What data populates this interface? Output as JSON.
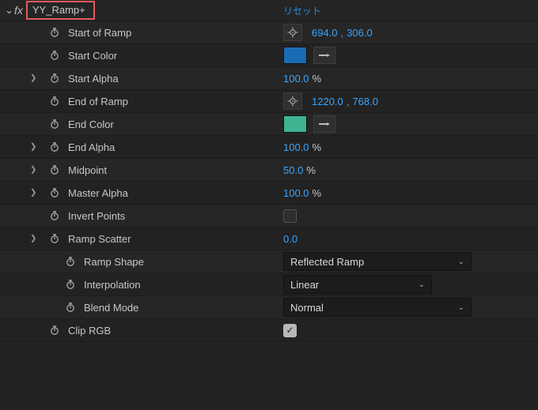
{
  "header": {
    "effect_name": "YY_Ramp+",
    "reset_label": "リセット"
  },
  "props": {
    "start_of_ramp": {
      "label": "Start of Ramp",
      "x": "694.0",
      "y": "306.0"
    },
    "start_color": {
      "label": "Start Color",
      "swatch": "#1a6bb3"
    },
    "start_alpha": {
      "label": "Start Alpha",
      "value": "100.0",
      "unit": "%"
    },
    "end_of_ramp": {
      "label": "End of Ramp",
      "x": "1220.0",
      "y": "768.0"
    },
    "end_color": {
      "label": "End Color",
      "swatch": "#3fb391"
    },
    "end_alpha": {
      "label": "End Alpha",
      "value": "100.0",
      "unit": "%"
    },
    "midpoint": {
      "label": "Midpoint",
      "value": "50.0",
      "unit": "%"
    },
    "master_alpha": {
      "label": "Master Alpha",
      "value": "100.0",
      "unit": "%"
    },
    "invert_points": {
      "label": "Invert Points",
      "checked": false
    },
    "ramp_scatter": {
      "label": "Ramp Scatter",
      "value": "0.0"
    },
    "ramp_shape": {
      "label": "Ramp Shape",
      "selected": "Reflected Ramp"
    },
    "interpolation": {
      "label": "Interpolation",
      "selected": "Linear"
    },
    "blend_mode": {
      "label": "Blend Mode",
      "selected": "Normal"
    },
    "clip_rgb": {
      "label": "Clip RGB",
      "checked": true
    }
  },
  "dropdown_widths": {
    "ramp_shape": 220,
    "interpolation": 170,
    "blend_mode": 220
  }
}
